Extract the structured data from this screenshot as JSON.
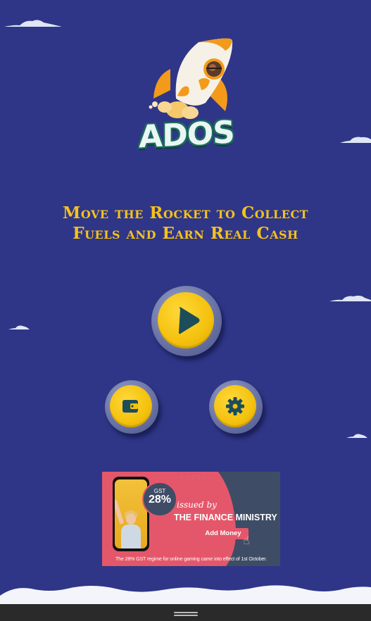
{
  "app": {
    "logo_text": "ADOS",
    "tagline_line1": "Move the Rocket to Collect",
    "tagline_line2": "Fuels and Earn Real Cash"
  },
  "buttons": {
    "play": "play-icon",
    "wallet": "wallet-icon",
    "settings": "gear-icon"
  },
  "ad": {
    "gst_label": "GST",
    "gst_value": "28%",
    "issued_by": "issued by",
    "ministry": "THE FINANCE MINISTRY",
    "cta": "Add Money",
    "footer": "The 28% GST regime for online gaming came into effect of 1st October."
  },
  "colors": {
    "background": "#2f3687",
    "accent_yellow": "#f6c21b",
    "button_ring": "#6b74a6",
    "ad_pink": "#e4576a",
    "ad_slate": "#3f4c66"
  }
}
